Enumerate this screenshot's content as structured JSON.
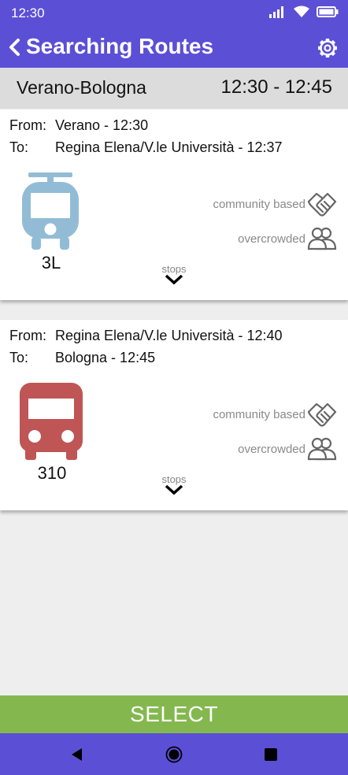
{
  "status_bar": {
    "time": "12:30"
  },
  "app_bar": {
    "title": "Searching Routes",
    "icons": [
      "back-chevron-icon",
      "gear-icon"
    ]
  },
  "route": {
    "name": "Verano-Bologna",
    "times": "12:30 - 12:45"
  },
  "legs": [
    {
      "from_label": "From:",
      "from": "Verano - 12:30",
      "to_label": "To:",
      "to": "Regina Elena/V.le Università - 12:37",
      "vehicle_icon": "tram-icon",
      "vehicle_color": "#92bcd6",
      "line": "3L",
      "feature1": "community based",
      "feature2": "overcrowded",
      "stops": "stops"
    },
    {
      "from_label": "From:",
      "from": "Regina Elena/V.le Università - 12:40",
      "to_label": "To:",
      "to": "Bologna - 12:45",
      "vehicle_icon": "bus-icon",
      "vehicle_color": "#bf5555",
      "line": "310",
      "feature1": "community based",
      "feature2": "overcrowded",
      "stops": "stops"
    }
  ],
  "select_label": "SELECT",
  "colors": {
    "primary": "#5b4fd6",
    "select": "#84b84f",
    "header_bg": "#dcdcdc"
  }
}
